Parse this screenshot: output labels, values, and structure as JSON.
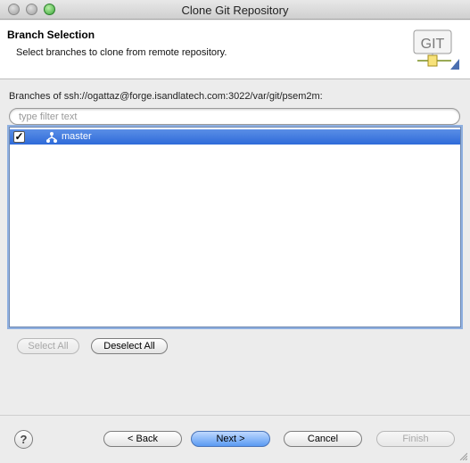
{
  "window": {
    "title": "Clone Git Repository"
  },
  "banner": {
    "title": "Branch Selection",
    "subtitle": "Select branches to clone from remote repository.",
    "logo_text": "GIT"
  },
  "branches": {
    "label": "Branches of ssh://ogattaz@forge.isandlatech.com:3022/var/git/psem2m:",
    "filter_placeholder": "type filter text",
    "filter_value": "",
    "items": [
      {
        "name": "master",
        "checked": true,
        "selected": true
      }
    ]
  },
  "selection_buttons": {
    "select_all": "Select All",
    "deselect_all": "Deselect All"
  },
  "footer": {
    "help": "?",
    "back": "< Back",
    "next": "Next >",
    "cancel": "Cancel",
    "finish": "Finish"
  },
  "colors": {
    "selection": "#3a76de",
    "window_bg": "#ececec"
  }
}
